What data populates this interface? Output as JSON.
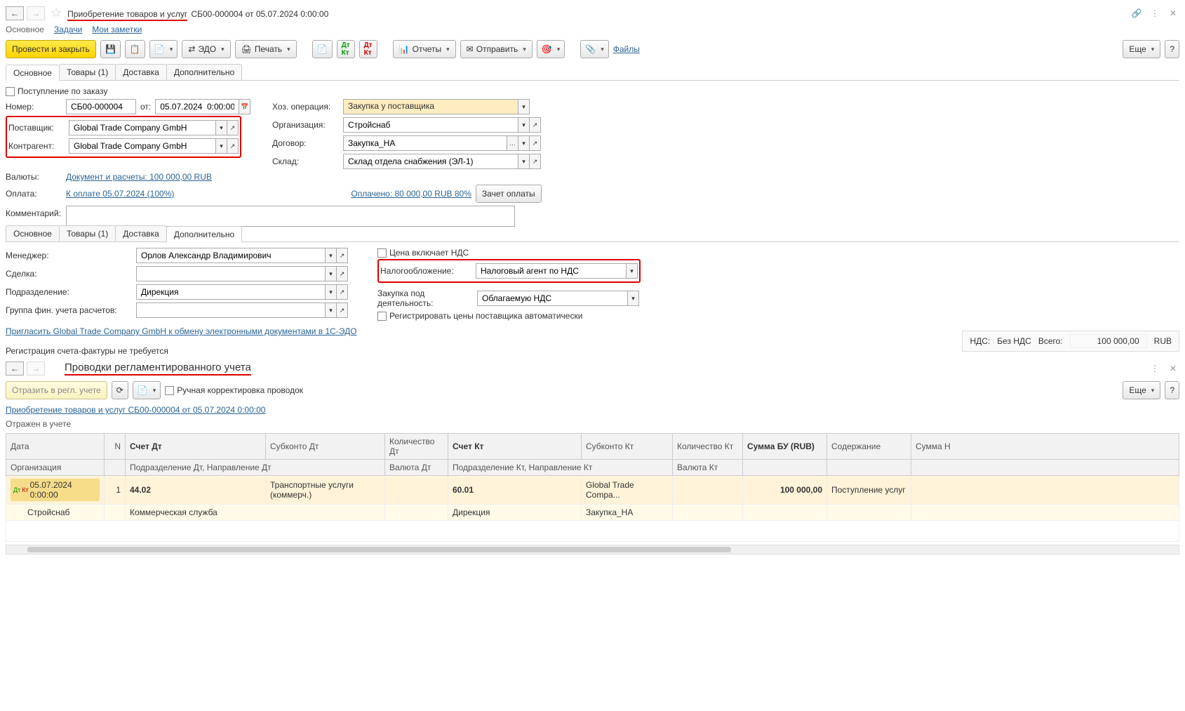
{
  "header": {
    "title_prefix": "Приобретение товаров и услуг",
    "title_suffix": "СБ00-000004 от 05.07.2024 0:00:00"
  },
  "linkbar": {
    "main": "Основное",
    "tasks": "Задачи",
    "notes": "Мои заметки"
  },
  "toolbar": {
    "post_close": "Провести и закрыть",
    "edo": "ЭДО",
    "print": "Печать",
    "reports": "Отчеты",
    "send": "Отправить",
    "files": "Файлы",
    "more": "Еще"
  },
  "tabs1": {
    "main": "Основное",
    "goods": "Товары (1)",
    "delivery": "Доставка",
    "extra": "Дополнительно"
  },
  "form1": {
    "by_order_label": "Поступление по заказу",
    "number_label": "Номер:",
    "number": "СБ00-000004",
    "from_label": "от:",
    "date": "05.07.2024  0:00:00",
    "op_label": "Хоз. операция:",
    "op": "Закупка у поставщика",
    "supplier_label": "Поставщик:",
    "supplier": "Global Trade Company GmbH",
    "org_label": "Организация:",
    "org": "Стройснаб",
    "counter_label": "Контрагент:",
    "counter": "Global Trade Company GmbH",
    "contract_label": "Договор:",
    "contract": "Закупка_НА",
    "warehouse_label": "Склад:",
    "warehouse": "Склад отдела снабжения (ЭЛ-1)",
    "currencies_label": "Валюты:",
    "currencies_link": "Документ и расчеты: 100 000,00 RUB",
    "payment_label": "Оплата:",
    "payment_link": "К оплате 05.07.2024 (100%)",
    "paid_link": "Оплачено: 80 000,00 RUB 80%",
    "offset_btn": "Зачет оплаты",
    "comment_label": "Комментарий:"
  },
  "tabs2": {
    "main": "Основное",
    "goods": "Товары (1)",
    "delivery": "Доставка",
    "extra": "Дополнительно"
  },
  "form2": {
    "manager_label": "Менеджер:",
    "manager": "Орлов Александр Владимирович",
    "deal_label": "Сделка:",
    "dept_label": "Подразделение:",
    "dept": "Дирекция",
    "group_label": "Группа фин. учета расчетов:",
    "vat_incl_label": "Цена включает НДС",
    "tax_label": "Налогообложение:",
    "tax": "Налоговый агент по НДС",
    "activity_label": "Закупка под деятельность:",
    "activity": "Облагаемую НДС",
    "auto_price_label": "Регистрировать цены поставщика автоматически"
  },
  "invite_link": "Пригласить Global Trade Company GmbH к обмену электронными документами в 1С-ЭДО",
  "invoice_note": "Регистрация счета-фактуры не требуется",
  "totals": {
    "vat_label": "НДС:",
    "vat": "Без НДС",
    "total_label": "Всего:",
    "total": "100 000,00",
    "cur": "RUB"
  },
  "section2": {
    "title": "Проводки регламентированного учета",
    "reflect_btn": "Отразить в регл. учете",
    "manual_label": "Ручная корректировка проводок",
    "doc_link": "Приобретение товаров и услуг СБ00-000004 от 05.07.2024 0:00:00",
    "status": "Отражен в учете",
    "more": "Еще"
  },
  "table": {
    "h1": {
      "date": "Дата",
      "n": "N",
      "acc_dt": "Счет Дт",
      "sub_dt": "Субконто Дт",
      "qty_dt": "Количество Дт",
      "acc_kt": "Счет Кт",
      "sub_kt": "Субконто Кт",
      "qty_kt": "Количество Кт",
      "sum": "Сумма БУ (RUB)",
      "content": "Содержание",
      "sum_n": "Сумма Н"
    },
    "h2": {
      "org": "Организация",
      "dept_dt": "Подразделение Дт, Направление Дт",
      "cur_dt": "Валюта Дт",
      "dept_kt": "Подразделение Кт, Направление Кт",
      "cur_kt": "Валюта Кт"
    },
    "row": {
      "date": "05.07.2024 0:00:00",
      "n": "1",
      "acc_dt": "44.02",
      "sub_dt": "Транспортные услуги (коммерч.)",
      "acc_kt": "60.01",
      "sub_kt": "Global Trade Compa...",
      "sum": "100 000,00",
      "content": "Поступление услуг",
      "org": "Стройснаб",
      "dept_dt": "Коммерческая служба",
      "dept_kt": "Дирекция",
      "contract_kt": "Закупка_НА"
    }
  }
}
